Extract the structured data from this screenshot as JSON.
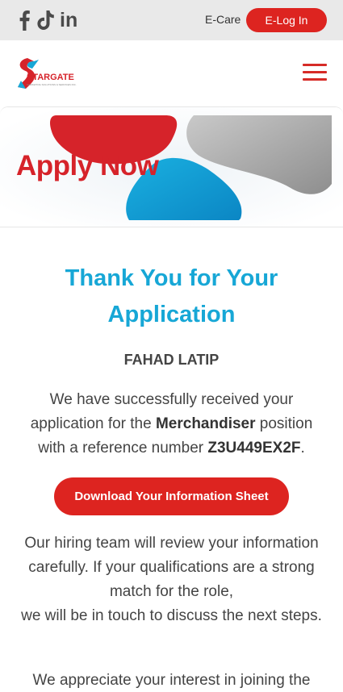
{
  "topbar": {
    "social": [
      "facebook-icon",
      "tiktok-icon",
      "linkedin-icon"
    ],
    "ecare_label": "E-Care",
    "login_label": "E-Log In"
  },
  "header": {
    "logo_text": "STARGATE",
    "logo_subtext": "MARKETING SOLUTIONS & SERVICES INC.",
    "menu_icon": "hamburger-menu-icon"
  },
  "banner": {
    "title": "Apply Now"
  },
  "main": {
    "heading_line1": "Thank You for Your",
    "heading_line2": "Application",
    "applicant_name": "FAHAD LATIP",
    "received_prefix": "We have successfully received your application for the ",
    "position": "Merchandiser",
    "received_middle": " position with a reference number ",
    "reference_number": "Z3U449EX2F",
    "received_suffix": ".",
    "download_label": "Download Your Information Sheet",
    "review_line1": "Our hiring team will review your information carefully. If your qualifications are a strong match for the role,",
    "review_line2": "we will be in touch to discuss the next steps.",
    "appreciate_text": "We appreciate your interest in joining the"
  },
  "colors": {
    "brand_red": "#dd2420",
    "heading_blue": "#17a7d6",
    "topbar_bg": "#e9e9e9",
    "text_gray": "#444444"
  }
}
